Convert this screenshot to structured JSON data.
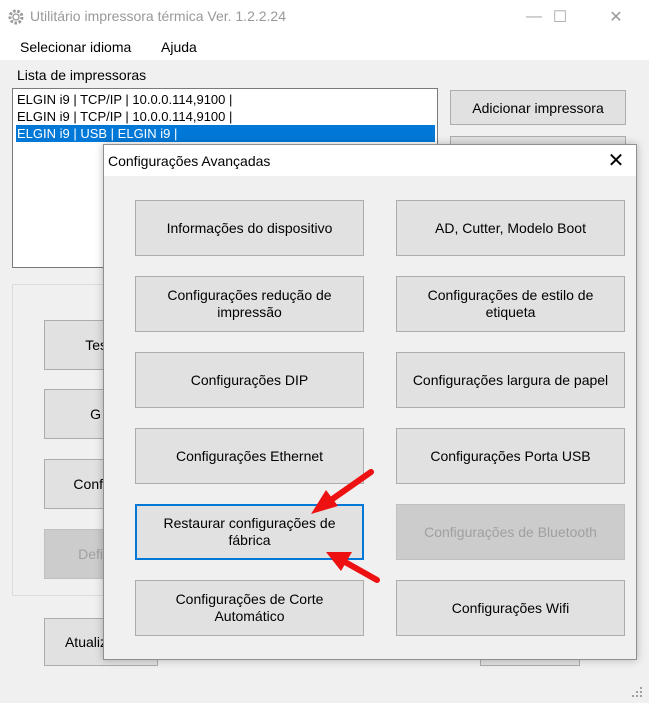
{
  "window": {
    "title": "Utilitário impressora térmica Ver. 1.2.2.24",
    "controls": {
      "minimize": "—",
      "maximize": "☐",
      "close": "✕"
    }
  },
  "menu": [
    "Selecionar idioma",
    "Ajuda"
  ],
  "printers": {
    "label": "Lista de impressoras",
    "items": [
      "ELGIN i9 | TCP/IP | 10.0.0.114,9100 |",
      "ELGIN i9 | TCP/IP | 10.0.0.114,9100 |",
      "ELGIN i9 | USB | ELGIN i9 |"
    ],
    "selected_index": 2
  },
  "buttons": {
    "add_printer": "Adicionar impressora",
    "partial_test": "Tes",
    "partial_g": "G",
    "partial_conf": "Conf",
    "partial_def": "Defi",
    "partial_update": "Atualiz"
  },
  "dialog": {
    "title": "Configurações Avançadas",
    "close": "✕",
    "buttons": [
      {
        "label": "Informações do dispositivo",
        "state": "normal"
      },
      {
        "label": "AD, Cutter, Modelo Boot",
        "state": "normal"
      },
      {
        "label": "Configurações redução de impressão",
        "state": "normal"
      },
      {
        "label": "Configurações de estilo de etiqueta",
        "state": "normal"
      },
      {
        "label": "Configurações DIP",
        "state": "normal"
      },
      {
        "label": "Configurações largura de papel",
        "state": "normal"
      },
      {
        "label": "Configurações Ethernet",
        "state": "normal"
      },
      {
        "label": "Configurações Porta USB",
        "state": "normal"
      },
      {
        "label": "Restaurar configurações de fábrica",
        "state": "focused"
      },
      {
        "label": "Configurações de Bluetooth",
        "state": "disabled"
      },
      {
        "label": "Configurações de Corte  Automático",
        "state": "normal"
      },
      {
        "label": "Configurações Wifi",
        "state": "normal"
      }
    ]
  },
  "colors": {
    "selection": "#0078d7",
    "annotation_arrow": "#ee1111"
  }
}
